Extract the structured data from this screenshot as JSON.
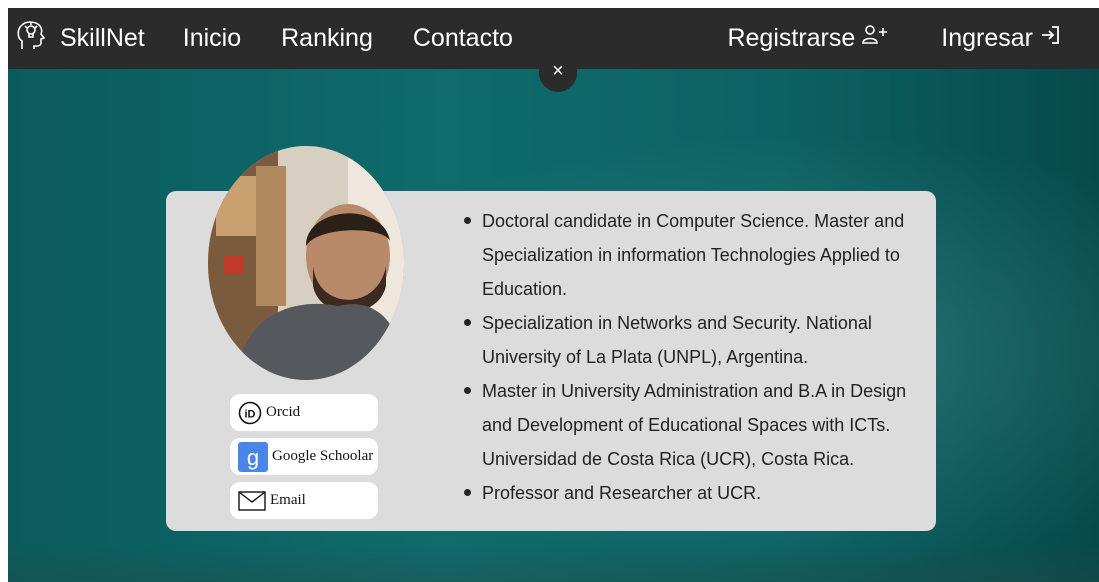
{
  "navbar": {
    "brand": "SkillNet",
    "links": [
      "Inicio",
      "Ranking",
      "Contacto"
    ],
    "register": "Registrarse",
    "login": "Ingresar",
    "background": "#2b2b2b"
  },
  "modal": {
    "close_label": "×",
    "card_background": "#dcdcdc",
    "links": {
      "orcid": "Orcid",
      "scholar": "Google Schoolar",
      "email": "Email"
    },
    "bio": [
      "Doctoral candidate in Computer Science. Master and Specialization in information Technologies Applied to Education.",
      "Specialization in Networks and Security. National University of La Plata (UNPL), Argentina.",
      "Master in University Administration and B.A in Design and Development of Educational Spaces with ICTs. Universidad de Costa Rica (UCR), Costa Rica.",
      "Professor and Researcher at UCR."
    ]
  },
  "icons": {
    "brand": "head-lightbulb-icon",
    "register": "add-user-icon",
    "login": "sign-in-icon",
    "orcid": "orcid-icon",
    "scholar": "google-scholar-icon",
    "email": "envelope-icon"
  },
  "colors": {
    "background_teal": "#0f6b6c",
    "scholar_blue": "#4a86e8"
  }
}
